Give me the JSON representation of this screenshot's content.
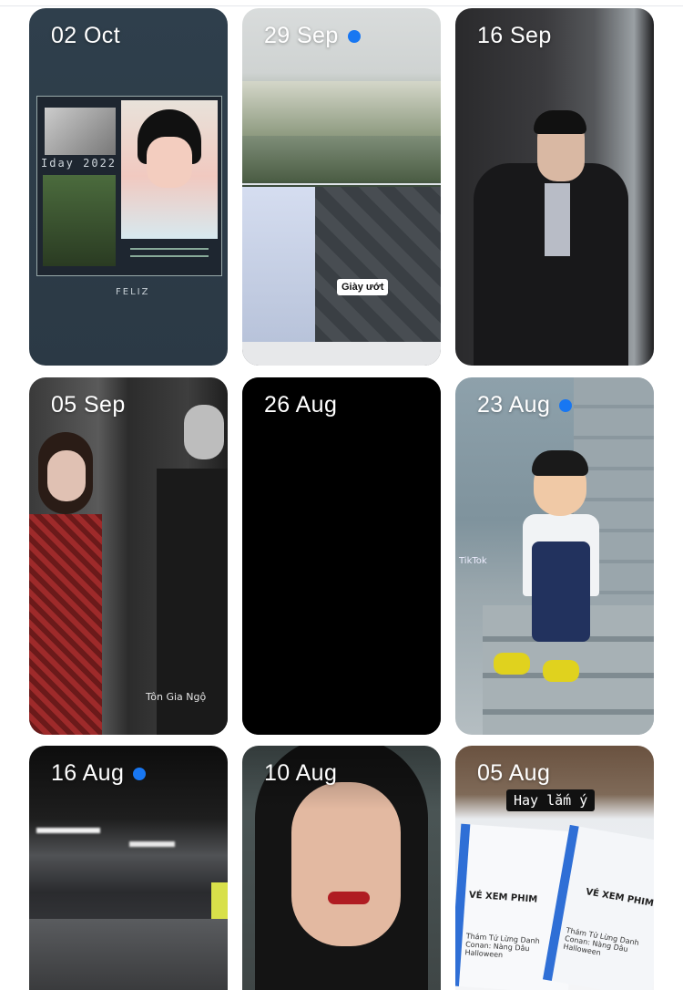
{
  "stories": [
    {
      "date": "02 Oct",
      "new": false,
      "overlay": {
        "collage_text": "Iday 2022",
        "logo": "FELIZ"
      }
    },
    {
      "date": "29 Sep",
      "new": true,
      "overlay": {
        "sticker": "Giày ướt"
      }
    },
    {
      "date": "16 Sep",
      "new": false,
      "overlay": {}
    },
    {
      "date": "05 Sep",
      "new": false,
      "overlay": {
        "name": "Tôn Gia Ngộ"
      }
    },
    {
      "date": "26 Aug",
      "new": false,
      "overlay": {}
    },
    {
      "date": "23 Aug",
      "new": true,
      "overlay": {
        "watermark": "TikTok"
      }
    },
    {
      "date": "16 Aug",
      "new": true,
      "overlay": {}
    },
    {
      "date": "10 Aug",
      "new": false,
      "overlay": {}
    },
    {
      "date": "05 Aug",
      "new": false,
      "overlay": {
        "caption": "Hay lắm ý",
        "ticket_title": "VÉ XEM PHIM",
        "ticket_movie": "Thám Tử Lừng Danh Conan: Nàng Dâu Halloween"
      }
    }
  ],
  "colors": {
    "accent_dot": "#1877f2"
  }
}
